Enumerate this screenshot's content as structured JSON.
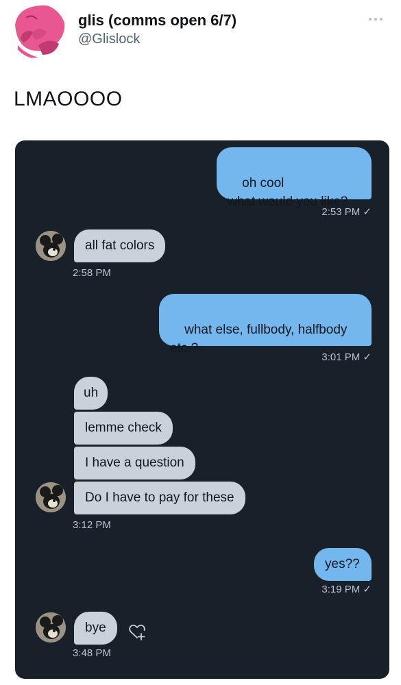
{
  "tweet": {
    "display_name": "glis (comms open 6/7)",
    "handle": "@Glislock",
    "text": "LMAOOOO"
  },
  "dm": {
    "messages": [
      {
        "side": "out",
        "text": "oh cool\nwhat would you like?",
        "time": "2:53 PM ✓"
      },
      {
        "side": "in",
        "text": "all fat colors",
        "time": "2:58 PM"
      },
      {
        "side": "out",
        "text": "what else, fullbody, halfbody\netc.?",
        "time": "3:01 PM ✓"
      },
      {
        "side": "in",
        "text": "uh"
      },
      {
        "side": "in",
        "text": "lemme check"
      },
      {
        "side": "in",
        "text": "I have a question"
      },
      {
        "side": "in",
        "text": "Do I have to pay for these",
        "time": "3:12 PM"
      },
      {
        "side": "out",
        "text": "yes??",
        "time": "3:19 PM ✓"
      },
      {
        "side": "in",
        "text": "bye",
        "time": "3:48 PM"
      }
    ]
  },
  "icons": {
    "more": "more-horizontal-icon",
    "like": "heart-plus-icon"
  },
  "colors": {
    "dm_background": "#18202a",
    "outgoing_bubble": "#74b6ee",
    "incoming_bubble": "#c9d2db",
    "avatar_pink": "#e8578f"
  }
}
